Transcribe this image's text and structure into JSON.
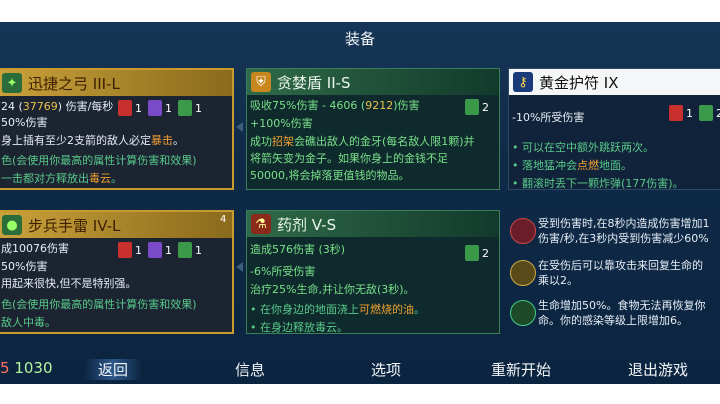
{
  "title": "装备",
  "cards": {
    "weapon1": {
      "name": "迅捷之弓 III-L",
      "stat_prefix": "24 (",
      "stat_highlight": "37769",
      "stat_suffix": ") 伤害/每秒",
      "line2": "50%伤害",
      "line3_pre": "身上插有至少2支箭的敌人必定",
      "line3_hl": "暴击",
      "line3_post": "。",
      "line4": "色(会使用你最高的属性计算伤害和效果)",
      "line5_pre": "一击都对方释放出",
      "line5_hl": "毒云",
      "line5_post": "。",
      "runes": [
        "1",
        "1",
        "1"
      ]
    },
    "shield": {
      "name": "贪婪盾 II-S",
      "line1_pre": "吸收75%伤害 - 4606 (",
      "line1_hl": "9212",
      "line1_post": ")伤害",
      "line2": "+100%伤害",
      "line3_pre": "成功",
      "line3_hl": "招架",
      "line3_post": "会礁出敌人的金牙(每名敌人限1颗)并",
      "line4": "将箭矢变为金子。如果你身上的金钱不足",
      "line5": "50000,将会掉落更值钱的物品。",
      "runes": [
        "2"
      ]
    },
    "amulet": {
      "name": "黄金护符 IX",
      "line1": "-10%所受伤害",
      "runes": [
        "1",
        "2"
      ],
      "bullets": [
        {
          "pre": "可以在空中额外跳跃两次。",
          "hl": "",
          "post": ""
        },
        {
          "pre": "落地猛冲会",
          "hl": "点燃",
          "post": "地面。"
        },
        {
          "pre": "翻滚时丢下一颗炸弹(177伤害)。",
          "hl": "",
          "post": ""
        }
      ]
    },
    "weapon2": {
      "name": "步兵手雷 IV-L",
      "count": "4",
      "line1": "成10076伤害",
      "line2": "50%伤害",
      "line3": "用起来很快,但不是特别强。",
      "line4": "色(会使用你最高的属性计算伤害和效果)",
      "line5": "敌人中毒。",
      "runes": [
        "1",
        "1",
        "1"
      ]
    },
    "potion": {
      "name": "药剂 V-S",
      "line1": "造成576伤害 (3秒)",
      "line2": "-6%所受伤害",
      "line3": "治疗25%生命,并让你无敌(3秒)。",
      "bullets": [
        {
          "pre": "在你身边的地面浇上",
          "hl": "可燃烧的油",
          "post": "。"
        },
        {
          "pre": "在身边释放毒云。",
          "hl": "",
          "post": ""
        }
      ],
      "runes": [
        "2"
      ]
    }
  },
  "abilities": [
    {
      "text": "受到伤害时,在8秒内造成伤害增加1",
      "text2": "伤害/秒,在3秒内受到伤害减少60%"
    },
    {
      "text": "在受伤后可以靠攻击来回复生命的",
      "text2": "乘以2。"
    },
    {
      "text": "生命增加50%。食物无法再恢复你",
      "text2": "命。你的感染等级上限增加6。"
    }
  ],
  "footer": {
    "money_prefix": "5",
    "money": "1030",
    "back": "返回",
    "info": "信息",
    "options": "选项",
    "restart": "重新开始",
    "quit": "退出游戏"
  },
  "colors": {
    "gold_frame": "#c99a2e",
    "green_frame": "#3b7f5a",
    "highlight_yellow": "#e9c24a",
    "highlight_orange": "#f0a030"
  }
}
